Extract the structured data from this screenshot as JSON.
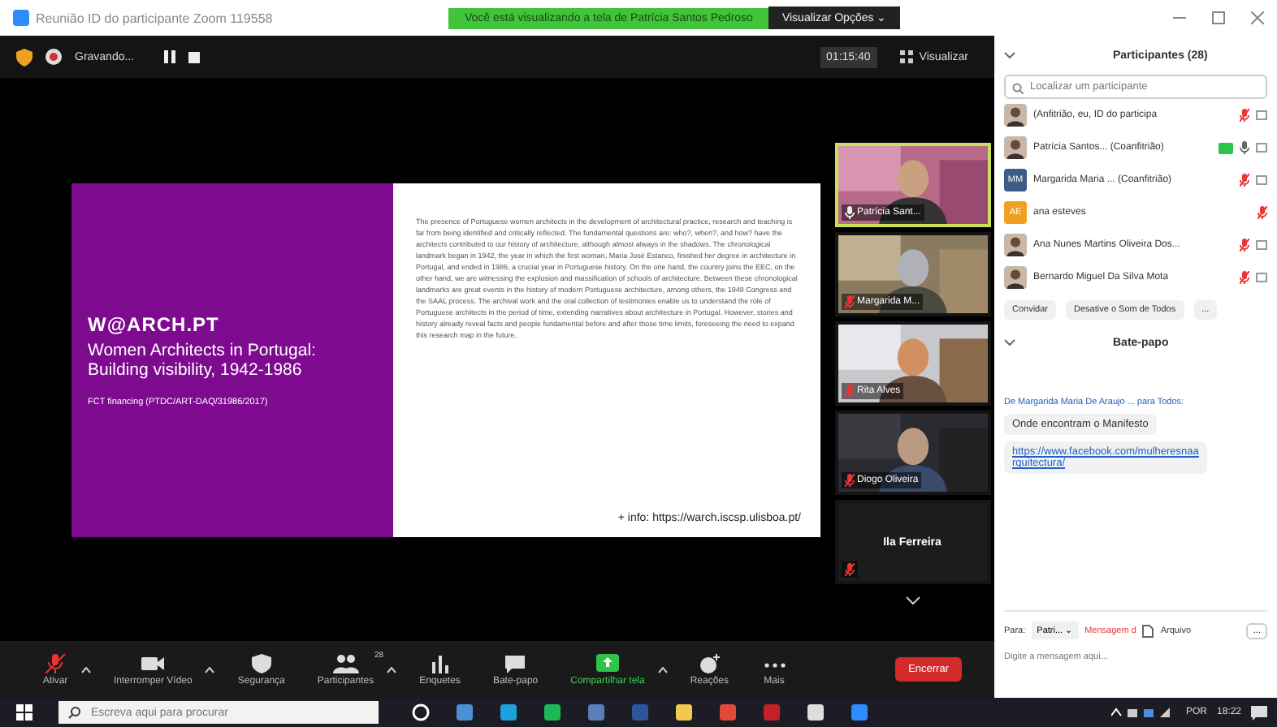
{
  "window": {
    "title": "Reunião ID do participante Zoom 119558",
    "banner": "Você está visualizando a tela de Patrícia Santos Pedroso",
    "view_options": "Visualizar Opções ⌄"
  },
  "top_bar": {
    "recording": "Gravando...",
    "timer": "01:15:40",
    "view": "Visualizar"
  },
  "slide": {
    "brand": "W@ARCH.PT",
    "title": "Women Architects in Portugal: Building visibility, 1942-1986",
    "funding": "FCT financing (PTDC/ART-DAQ/31986/2017)",
    "body": "The presence of Portuguese women architects in the development of architectural practice, research and teaching is far from being identified and critically reflected. The fundamental questions are: who?, when?, and how? have the architects contributed to our history of architecture, although almost always in the shadows. The chronological landmark began in 1942, the year in which the first woman, Maria José Estanco, finished her degree in architecture in Portugal, and ended in 1986, a crucial year in Portuguese history. On the one hand, the country joins the EEC, on the other hand, we are witnessing the explosion and massification of schools of architecture. Between these chronological landmarks are great events in the history of modern Portuguese architecture, among others, the 1948 Congress and the SAAL process. The archival work and the oral collection of testimonies enable us to understand the role of Portuguese architects in the period of time, extending narratives about architecture in Portugal. However, stories and history already reveal facts and people fundamental before and after those time limits, foreseeing the need to expand this research map in the future.",
    "link": "+ info: https://warch.iscsp.ulisboa.pt/"
  },
  "videos": [
    {
      "kind": "picture",
      "name": "Patrícia Sant...",
      "active": true,
      "muted": false
    },
    {
      "kind": "picture",
      "name": "Margarida M...",
      "active": false,
      "muted": true
    },
    {
      "kind": "picture",
      "name": "Rita Alves",
      "active": false,
      "muted": true
    },
    {
      "kind": "picture",
      "name": "Diogo Oliveira",
      "active": false,
      "muted": true
    },
    {
      "kind": "name",
      "name": "Ila Ferreira",
      "active": false,
      "muted": true
    }
  ],
  "participants": {
    "title": "Participantes (28)",
    "search": {
      "placeholder": "Localizar um participante"
    },
    "items": [
      {
        "name": "(Anfitrião, eu, ID do participa",
        "muted": true,
        "sharing": false
      },
      {
        "name": "Patrícia Santos... (Coanfitrião)",
        "muted": false,
        "sharing": true
      },
      {
        "kind": "initials",
        "initials": "MM",
        "color": "#3f5b86",
        "name": "Margarida Maria ... (Coanfitrião)",
        "muted": true,
        "sharing": false
      },
      {
        "kind": "initials",
        "initials": "AE",
        "color": "#f0a020",
        "name": "ana esteves",
        "muted": true,
        "sharing": false
      },
      {
        "name": "Ana Nunes Martins Oliveira Dos...",
        "muted": true,
        "sharing": false
      },
      {
        "name": "Bernardo Miguel Da Silva Mota",
        "muted": true,
        "sharing": false
      }
    ],
    "buttons": [
      "Convidar",
      "Desative o Som de Todos",
      "..."
    ]
  },
  "chat": {
    "title": "Bate-papo",
    "from": "De Margarida Maria De Araujo ... para Todos:",
    "messages": [
      {
        "kind": "text",
        "text": "Onde encontram o Manifesto"
      },
      {
        "kind": "link",
        "text": "https://www.facebook.com/mulheresnaarquitectura/"
      }
    ],
    "to_label": "Para:",
    "to": "Patri... ⌄",
    "message_label": "Mensagem d",
    "file": "Arquivo",
    "more": "...",
    "placeholder": "Digite a mensagem aqui..."
  },
  "toolbar": [
    {
      "kind": "mic",
      "label": "Ativar",
      "caret": true
    },
    {
      "kind": "video",
      "label": "Interromper Vídeo",
      "caret": true
    },
    {
      "kind": "shield",
      "label": "Segurança",
      "caret": false
    },
    {
      "kind": "people",
      "label": "Participantes",
      "caret": true,
      "count": "28"
    },
    {
      "kind": "poll",
      "label": "Enquetes",
      "caret": false
    },
    {
      "kind": "chat",
      "label": "Bate-papo",
      "caret": false
    },
    {
      "kind": "share",
      "label": "Compartilhar tela",
      "caret": true
    },
    {
      "kind": "react",
      "label": "Reações",
      "caret": false
    },
    {
      "kind": "more",
      "label": "Mais",
      "caret": false
    }
  ],
  "end_button": "Encerrar",
  "taskbar": {
    "search": {
      "placeholder": "Escreva aqui para procurar"
    },
    "language": "POR",
    "time": "18:22"
  }
}
